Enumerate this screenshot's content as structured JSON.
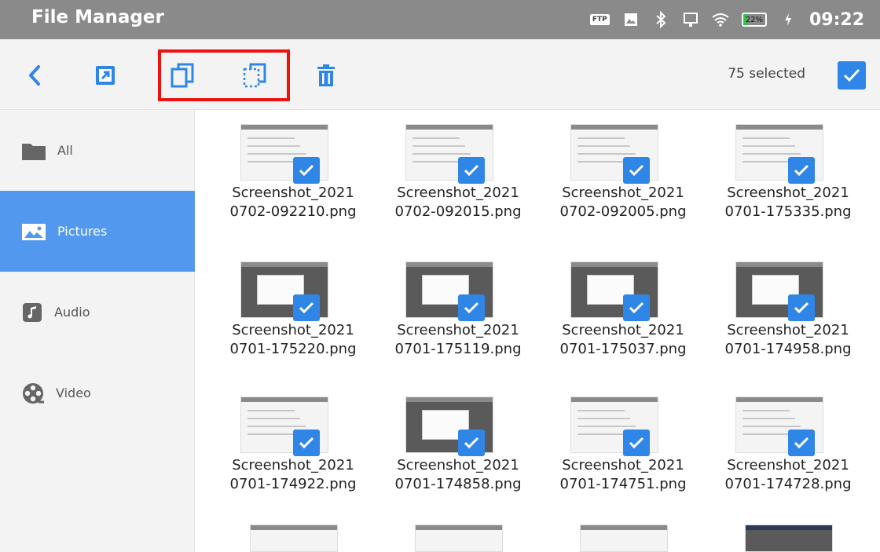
{
  "status_bar": {
    "app_title": "File Manager",
    "ftp_badge": "FTP",
    "battery": "22%",
    "time": "09:22"
  },
  "toolbar": {
    "selected_count": "75 selected"
  },
  "sidebar": {
    "items": [
      {
        "label": "All"
      },
      {
        "label": "Pictures"
      },
      {
        "label": "Audio"
      },
      {
        "label": "Video"
      }
    ]
  },
  "files": [
    {
      "name_line1": "Screenshot_2021",
      "name_line2": "0702-092210.png"
    },
    {
      "name_line1": "Screenshot_2021",
      "name_line2": "0702-092015.png"
    },
    {
      "name_line1": "Screenshot_2021",
      "name_line2": "0702-092005.png"
    },
    {
      "name_line1": "Screenshot_2021",
      "name_line2": "0701-175335.png"
    },
    {
      "name_line1": "Screenshot_2021",
      "name_line2": "0701-175220.png"
    },
    {
      "name_line1": "Screenshot_2021",
      "name_line2": "0701-175119.png"
    },
    {
      "name_line1": "Screenshot_2021",
      "name_line2": "0701-175037.png"
    },
    {
      "name_line1": "Screenshot_2021",
      "name_line2": "0701-174958.png"
    },
    {
      "name_line1": "Screenshot_2021",
      "name_line2": "0701-174922.png"
    },
    {
      "name_line1": "Screenshot_2021",
      "name_line2": "0701-174858.png"
    },
    {
      "name_line1": "Screenshot_2021",
      "name_line2": "0701-174751.png"
    },
    {
      "name_line1": "Screenshot_2021",
      "name_line2": "0701-174728.png"
    }
  ],
  "colors": {
    "accent": "#2f86e6",
    "sidebar_active": "#5398ef",
    "status_bar": "#8a8a8a",
    "highlight": "#ee1111"
  }
}
